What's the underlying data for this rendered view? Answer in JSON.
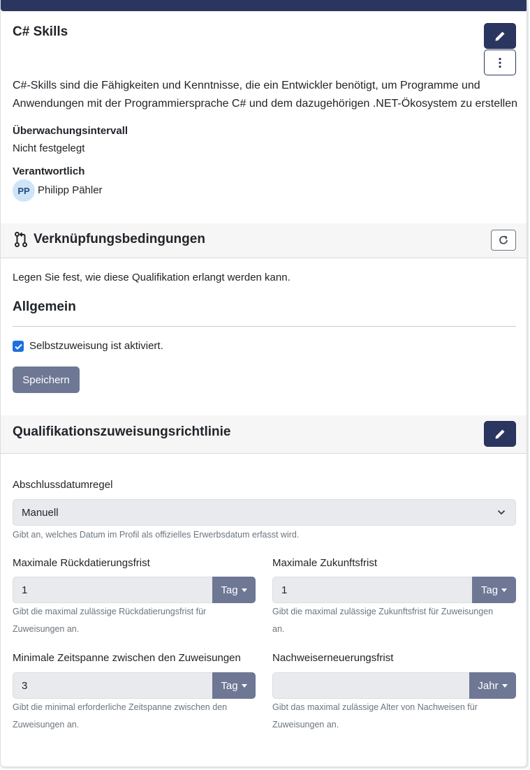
{
  "skill": {
    "title": "C# Skills",
    "description": "C#-Skills sind die Fähigkeiten und Kenntnisse, die ein Entwickler benötigt, um Programme und Anwendungen mit der Programmiersprache C# und dem dazugehörigen .NET-Ökosystem zu erstellen",
    "interval_label": "Überwachungsintervall",
    "interval_value": "Nicht festgelegt",
    "owner_label": "Verantwortlich",
    "owner_initials": "PP",
    "owner_name": "Philipp Pähler"
  },
  "linking": {
    "title": "Verknüpfungsbedingungen",
    "intro": "Legen Sie fest, wie diese Qualifikation erlangt werden kann.",
    "general_heading": "Allgemein",
    "self_assign_label": "Selbstzuweisung ist aktiviert.",
    "self_assign_checked": true,
    "save_label": "Speichern"
  },
  "policy": {
    "title": "Qualifikationszuweisungsrichtlinie",
    "completion_rule": {
      "label": "Abschlussdatumregel",
      "value": "Manuell",
      "help": "Gibt an, welches Datum im Profil als offizielles Erwerbsdatum erfasst wird."
    },
    "max_backdate": {
      "label": "Maximale Rückdatierungsfrist",
      "value": "1",
      "unit": "Tag",
      "help": "Gibt die maximal zulässige Rückdatierungsfrist für Zuweisungen an."
    },
    "max_future": {
      "label": "Maximale Zukunftsfrist",
      "value": "1",
      "unit": "Tag",
      "help": "Gibt die maximal zulässige Zukunftsfrist für Zuweisungen an."
    },
    "min_gap": {
      "label": "Minimale Zeitspanne zwischen den Zuweisungen",
      "value": "3",
      "unit": "Tag",
      "help": "Gibt die minimal erforderliche Zeitspanne zwischen den Zuweisungen an."
    },
    "proof_renewal": {
      "label": "Nachweiserneuerungsfrist",
      "value": "",
      "unit": "Jahr",
      "help": "Gibt das maximal zulässige Alter von Nachweisen für Zuweisungen an."
    }
  },
  "icons": {
    "edit": "pencil-icon",
    "more": "kebab-menu-icon",
    "linking": "git-pull-request-icon",
    "refresh": "refresh-icon",
    "checkbox": "check-icon",
    "select": "chevron-down-icon",
    "dropdown": "caret-down-icon"
  },
  "colors": {
    "primary": "#2b3660",
    "secondary_button": "#6e7894",
    "checkbox": "#1d6fe0",
    "avatar_bg": "#cfe4f7",
    "input_bg": "#e9eaed"
  }
}
